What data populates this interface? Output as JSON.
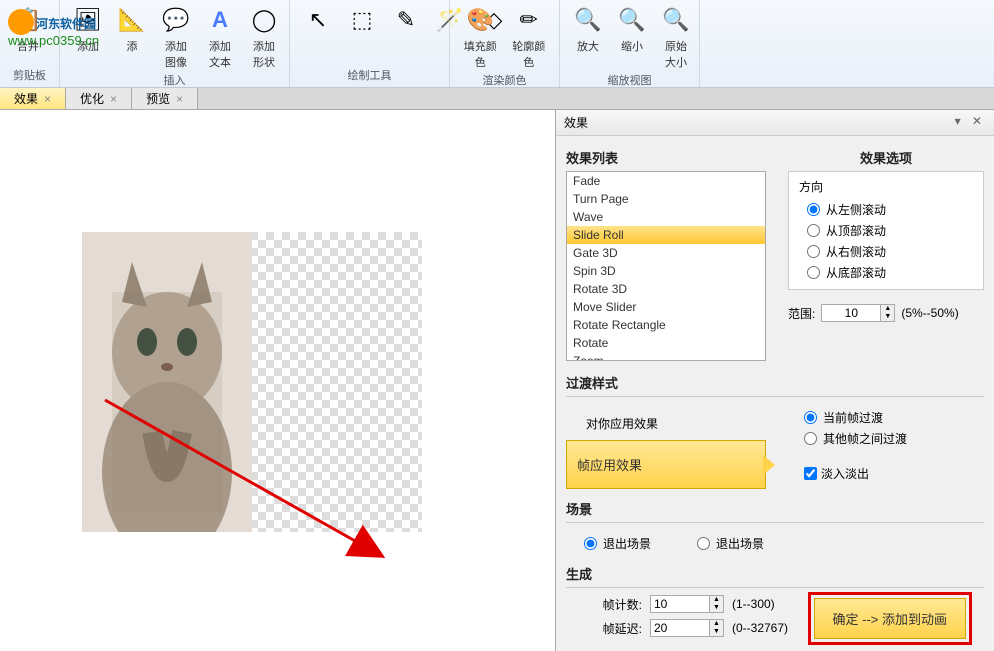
{
  "watermark": {
    "text1": "河东软件园",
    "text2": "www.pc0359.cn"
  },
  "ribbon": {
    "groups": [
      {
        "label": "剪贴板",
        "items": [
          {
            "label": "合并",
            "icon": "📋"
          }
        ]
      },
      {
        "label": "插入",
        "items": [
          {
            "label": "添加",
            "icon": "🖼"
          },
          {
            "label": "添",
            "icon": "📐"
          },
          {
            "label": "添加图像",
            "icon": "💬"
          },
          {
            "label": "添加文本",
            "icon": "A"
          },
          {
            "label": "添加形状",
            "icon": "◯"
          }
        ]
      },
      {
        "label": "绘制工具",
        "items": [
          {
            "label": "",
            "icon": "↖"
          },
          {
            "label": "",
            "icon": "⬚"
          },
          {
            "label": "",
            "icon": "✎"
          },
          {
            "label": "",
            "icon": "🪄"
          },
          {
            "label": "",
            "icon": "◇"
          }
        ]
      },
      {
        "label": "渲染颜色",
        "items": [
          {
            "label": "填充颜色",
            "icon": "🎨"
          },
          {
            "label": "轮廓颜色",
            "icon": "✏"
          }
        ]
      },
      {
        "label": "缩放视图",
        "items": [
          {
            "label": "放大",
            "icon": "🔍+"
          },
          {
            "label": "缩小",
            "icon": "🔍-"
          },
          {
            "label": "原始大小",
            "icon": "🔍"
          }
        ]
      }
    ]
  },
  "tabs": [
    {
      "label": "效果",
      "active": true
    },
    {
      "label": "优化",
      "active": false
    },
    {
      "label": "预览",
      "active": false
    }
  ],
  "panel": {
    "title": "效果",
    "list_title": "效果列表",
    "options_title": "效果选项",
    "effects": [
      "Fade",
      "Turn Page",
      "Wave",
      "Slide Roll",
      "Gate 3D",
      "Spin 3D",
      "Rotate 3D",
      "Move Slider",
      "Rotate Rectangle",
      "Rotate",
      "Zoom"
    ],
    "selected_effect": "Slide Roll",
    "direction": {
      "title": "方向",
      "opts": [
        "从左侧滚动",
        "从顶部滚动",
        "从右侧滚动",
        "从底部滚动"
      ],
      "selected": 0
    },
    "range": {
      "label": "范围:",
      "value": "10",
      "hint": "(5%--50%)"
    },
    "transition_title": "过渡样式",
    "apply_label": "对你应用效果",
    "apply_btn": "帧应用效果",
    "transition_opts": [
      "当前帧过渡",
      "其他帧之间过渡"
    ],
    "transition_selected": 0,
    "fade_check": "淡入淡出",
    "scene_title": "场景",
    "scene_opts": [
      "退出场景",
      "退出场景"
    ],
    "scene_selected": 0,
    "gen_title": "生成",
    "frame_count": {
      "label": "帧计数:",
      "value": "10",
      "hint": "(1--300)"
    },
    "frame_delay": {
      "label": "帧延迟:",
      "value": "20",
      "hint": "(0--32767)"
    },
    "confirm_btn": "确定 --> 添加到动画"
  }
}
